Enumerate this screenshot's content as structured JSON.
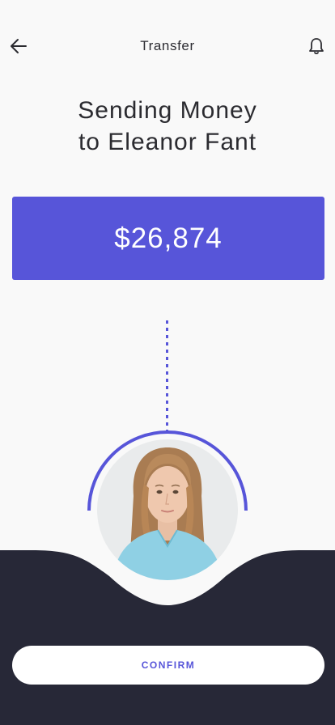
{
  "header": {
    "title": "Transfer",
    "back_icon": "arrow-left-icon",
    "notification_icon": "bell-icon"
  },
  "headline": {
    "line1": "Sending Money",
    "line2": "to Eleanor Fant"
  },
  "amount": {
    "value": "$26,874"
  },
  "recipient": {
    "avatar": "recipient-avatar"
  },
  "actions": {
    "confirm_label": "CONFIRM"
  },
  "colors": {
    "accent": "#5755d9",
    "background": "#f9f9f9",
    "panel": "#272837",
    "button_bg": "#ffffff"
  }
}
